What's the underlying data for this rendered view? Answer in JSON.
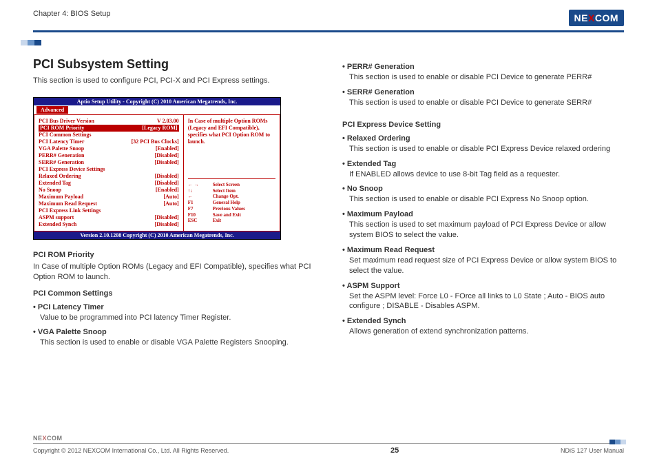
{
  "header": {
    "chapter": "Chapter 4: BIOS Setup",
    "logo_text": "NEXCOM"
  },
  "left": {
    "title": "PCI Subsystem Setting",
    "intro": "This section is used to configure PCI, PCI-X and PCI Express settings.",
    "rom_head": "PCI ROM Priority",
    "rom_desc": "In Case of multiple Option ROMs (Legacy and EFI Compatible), specifies what PCI Option ROM to launch.",
    "common_head": "PCI Common Settings",
    "lat_head": "PCI Latency Timer",
    "lat_desc": "Value to be programmed into PCI latency Timer Register.",
    "vga_head": "VGA Palette Snoop",
    "vga_desc": "This section is used to enable or disable VGA Palette Registers Snooping."
  },
  "right": {
    "perr_head": "PERR# Generation",
    "perr_desc": "This section is used to enable or disable PCI Device to generate PERR#",
    "serr_head": "SERR# Generation",
    "serr_desc": "This section is used to enable or disable PCI Device to generate SERR#",
    "pcie_head": "PCI Express Device Setting",
    "relax_head": "Relaxed Ordering",
    "relax_desc": "This section is used to enable or disable PCI Express Device relaxed ordering",
    "ext_head": "Extended Tag",
    "ext_desc": "If ENABLED allows device to use 8-bit Tag field as a requester.",
    "nosnoop_head": "No Snoop",
    "nosnoop_desc": "This section is used to enable or disable PCI Express No Snoop option.",
    "maxp_head": "Maximum Payload",
    "maxp_desc": "This section is used to set maximum payload of PCI Express Device or allow system BIOS to select the value.",
    "maxr_head": "Maximum Read Request",
    "maxr_desc": "Set maximum read request size of PCI Express Device or allow system BIOS to select the value.",
    "aspm_head": "ASPM Support",
    "aspm_desc": "Set the ASPM level: Force L0 - FOrce all links to L0 State ; Auto - BIOS auto configure ; DISABLE - Disables ASPM.",
    "synch_head": "Extended Synch",
    "synch_desc": "Allows generation of extend synchronization patterns."
  },
  "bios": {
    "top": "Aptio  Setup  Utility - Copyright (C) 2010 American Megatrends, Inc.",
    "tab": "Advanced",
    "rows": [
      {
        "k": "PCI Bus Driver Version",
        "v": "V 2.03.00"
      },
      {
        "k": "PCI ROM Priority",
        "v": "[Legacy ROM]",
        "hi": true
      },
      {
        "k": "PCI Common Settings",
        "v": ""
      },
      {
        "k": "PCI Latency Timer",
        "v": "[32 PCI Bus Clocks]"
      },
      {
        "k": "VGA Palette Snoop",
        "v": "[Enabled]"
      },
      {
        "k": "PERR# Generation",
        "v": "[Disabled]"
      },
      {
        "k": "SERR# Generation",
        "v": "[Disabled]"
      },
      {
        "k": "",
        "v": ""
      },
      {
        "k": "PCI Express Device Settings",
        "v": ""
      },
      {
        "k": "Relaxed Ordering",
        "v": "[Disabled]"
      },
      {
        "k": "Extended Tag",
        "v": "[Disabled]"
      },
      {
        "k": "No Snoop",
        "v": "[Enabled]"
      },
      {
        "k": "Maximum Payload",
        "v": "[Auto]"
      },
      {
        "k": "Maximum Read Request",
        "v": "[Auto]"
      },
      {
        "k": "",
        "v": ""
      },
      {
        "k": "PCI Express Link Settings",
        "v": ""
      },
      {
        "k": "ASPM support",
        "v": "[Disabled]"
      },
      {
        "k": "Extended Synch",
        "v": "[Disabled]"
      }
    ],
    "tip": "In Case of multiple Option ROMs (Legacy and EFI Compatible), specifies what PCI Option ROM to launch.",
    "help": [
      {
        "k": "← →",
        "v": "Select Screen"
      },
      {
        "k": "↑↓",
        "v": "Select Item"
      },
      {
        "k": "←",
        "v": "Change Opt."
      },
      {
        "k": "F1",
        "v": "General Help"
      },
      {
        "k": "F7",
        "v": "Previous Values"
      },
      {
        "k": "F10",
        "v": "Save and Exit"
      },
      {
        "k": "ESC",
        "v": "Exit"
      }
    ],
    "foot": "Version 2.10.1208 Copyright (C) 2010 American Megatrends, Inc."
  },
  "footer": {
    "logo": "NEXCOM",
    "copyright": "Copyright © 2012 NEXCOM International Co., Ltd. All Rights Reserved.",
    "page": "25",
    "manual": "NDiS 127 User Manual"
  }
}
